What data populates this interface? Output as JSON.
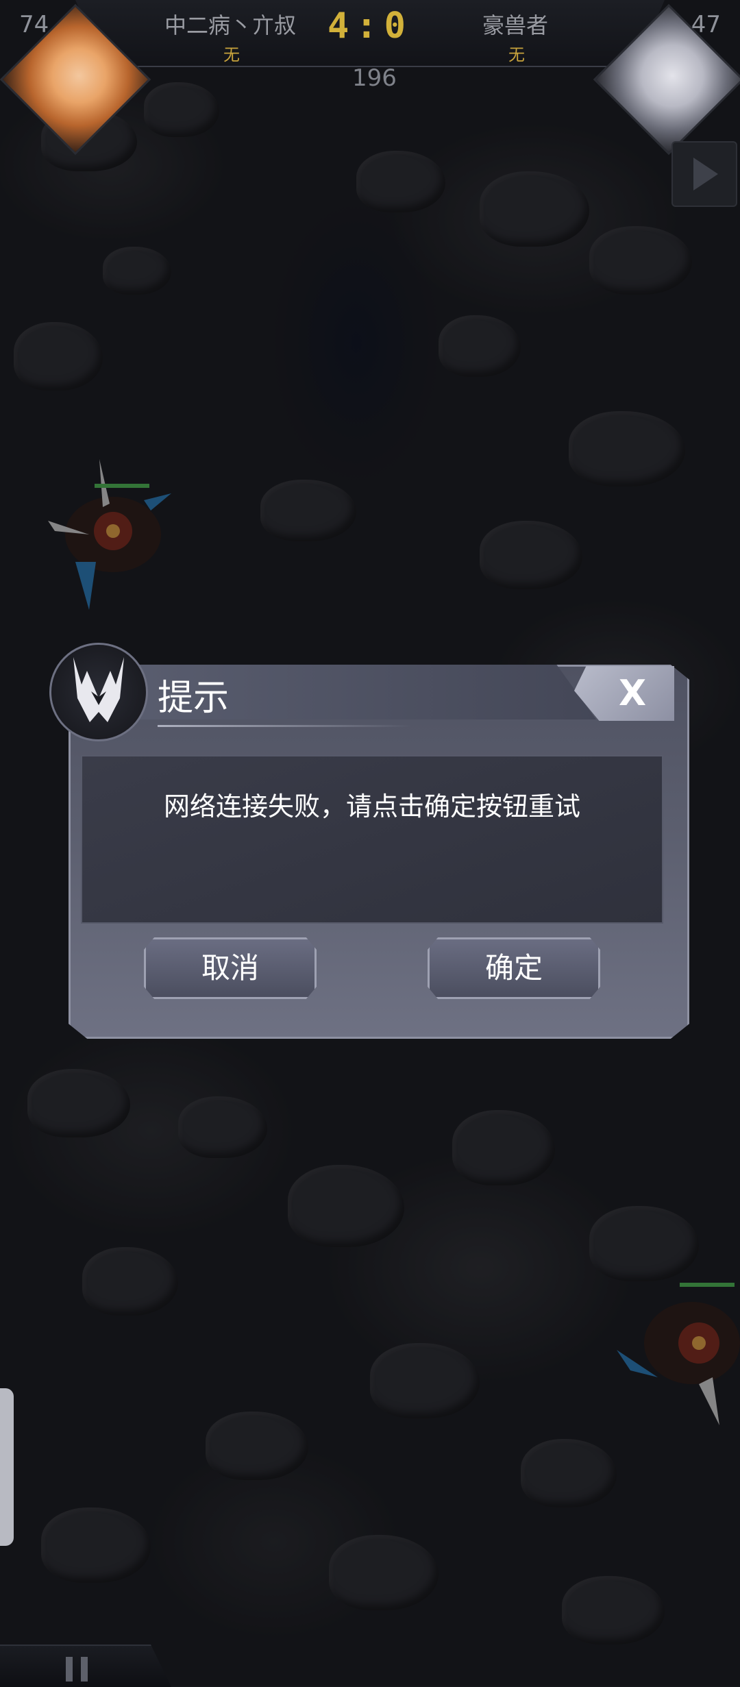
{
  "hud": {
    "left_player": {
      "level": "74",
      "name": "中二病丶亣叔",
      "status": "无"
    },
    "right_player": {
      "level": "47",
      "name": "豪兽者",
      "status": "无"
    },
    "score": "4:0",
    "timer": "196"
  },
  "dialog": {
    "title": "提示",
    "close_label": "X",
    "message": "网络连接失败，请点击确定按钮重试",
    "cancel_label": "取消",
    "confirm_label": "确定"
  },
  "icons": {
    "play": "play-icon",
    "pause": "pause-icon",
    "emblem": "mecha-emblem-icon"
  },
  "colors": {
    "score": "#d2b13a",
    "status": "#c8a33c",
    "hp_bar": "#4caf50",
    "dialog_panel": "#5a5d6d"
  }
}
